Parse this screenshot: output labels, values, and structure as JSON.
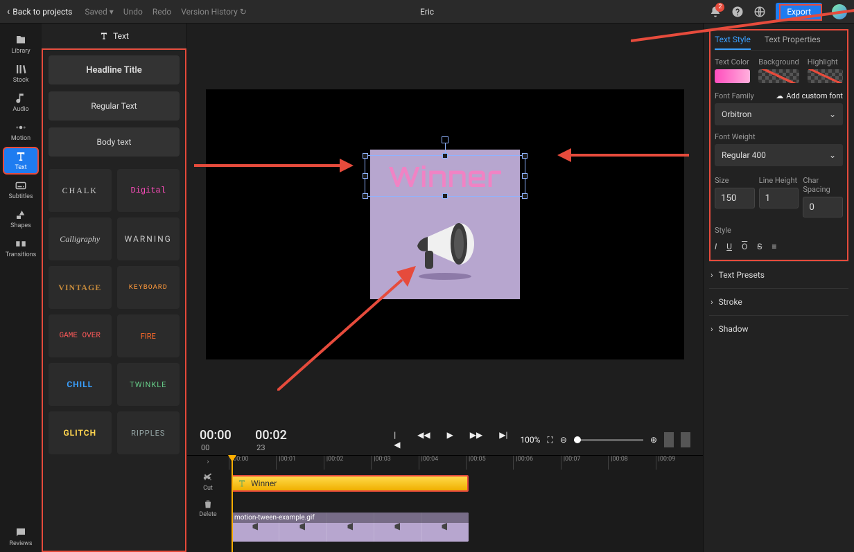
{
  "topbar": {
    "back": "Back to projects",
    "saved": "Saved",
    "undo": "Undo",
    "redo": "Redo",
    "history": "Version History",
    "project_title": "Eric",
    "export": "Export",
    "notification_count": "2"
  },
  "nav": {
    "library": "Library",
    "stock": "Stock",
    "audio": "Audio",
    "motion": "Motion",
    "text": "Text",
    "subtitles": "Subtitles",
    "shapes": "Shapes",
    "transitions": "Transitions",
    "reviews": "Reviews"
  },
  "panel": {
    "title": "Text",
    "presets": {
      "headline": "Headline Title",
      "regular": "Regular Text",
      "body": "Body text"
    },
    "styles": [
      "CHALK",
      "Digital",
      "Calligraphy",
      "WARNING",
      "VINTAGE",
      "KEYBOARD",
      "GAME OVER",
      "FIRE",
      "CHILL",
      "TWINKLE",
      "GLITCH",
      "RIPPLES"
    ]
  },
  "canvas": {
    "text_value": "Winner"
  },
  "playbar": {
    "current": "00:00",
    "current_frames": "00",
    "total": "00:02",
    "total_frames": "23",
    "zoom_pct": "100%"
  },
  "timeline": {
    "ticks": [
      "|00:00",
      "|00:01",
      "|00:02",
      "|00:03",
      "|00:04",
      "|00:05",
      "|00:06",
      "|00:07",
      "|00:08",
      "|00:09"
    ],
    "text_clip": "Winner",
    "media_clip": "motion-tween-example.gif",
    "side": {
      "cut": "Cut",
      "delete": "Delete"
    }
  },
  "props": {
    "tab_style": "Text Style",
    "tab_properties": "Text Properties",
    "text_color": "Text Color",
    "background": "Background",
    "highlight": "Highlight",
    "font_family_label": "Font Family",
    "add_font": "Add custom font",
    "font_family": "Orbitron",
    "font_weight_label": "Font Weight",
    "font_weight": "Regular 400",
    "size_label": "Size",
    "lineheight_label": "Line Height",
    "charspacing_label": "Char Spacing",
    "size": "150",
    "lineheight": "1",
    "charspacing": "0",
    "style_label": "Style",
    "presets": "Text Presets",
    "stroke": "Stroke",
    "shadow": "Shadow"
  }
}
